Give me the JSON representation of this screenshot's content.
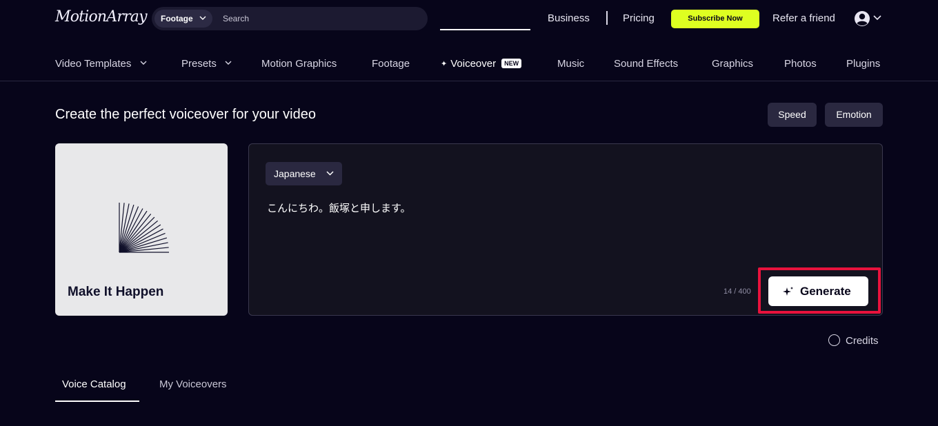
{
  "header": {
    "logo": "MotionArray",
    "search": {
      "category": "Footage",
      "placeholder": "Search"
    },
    "links": {
      "business": "Business",
      "pricing": "Pricing",
      "refer": "Refer a friend"
    },
    "subscribe_label": "Subscribe Now",
    "accent_color": "#deff21"
  },
  "nav": {
    "items": [
      {
        "label": "Video Templates"
      },
      {
        "label": "Presets"
      },
      {
        "label": "Motion Graphics"
      },
      {
        "label": "Footage"
      },
      {
        "label": "Voiceover",
        "badge": "NEW"
      },
      {
        "label": "Music"
      },
      {
        "label": "Sound Effects"
      },
      {
        "label": "Graphics"
      },
      {
        "label": "Photos"
      },
      {
        "label": "Plugins"
      }
    ]
  },
  "main": {
    "headline": "Create the perfect voiceover for your video",
    "speed_label": "Speed",
    "emotion_label": "Emotion",
    "card_title": "Make It Happen",
    "language": "Japanese",
    "text": "こんにちわ。飯塚と申します。",
    "counter": "14 / 400",
    "generate_label": "Generate",
    "credits_label": "Credits",
    "highlight_color": "#e8123d"
  },
  "tabs": [
    {
      "label": "Voice Catalog"
    },
    {
      "label": "My Voiceovers"
    }
  ]
}
